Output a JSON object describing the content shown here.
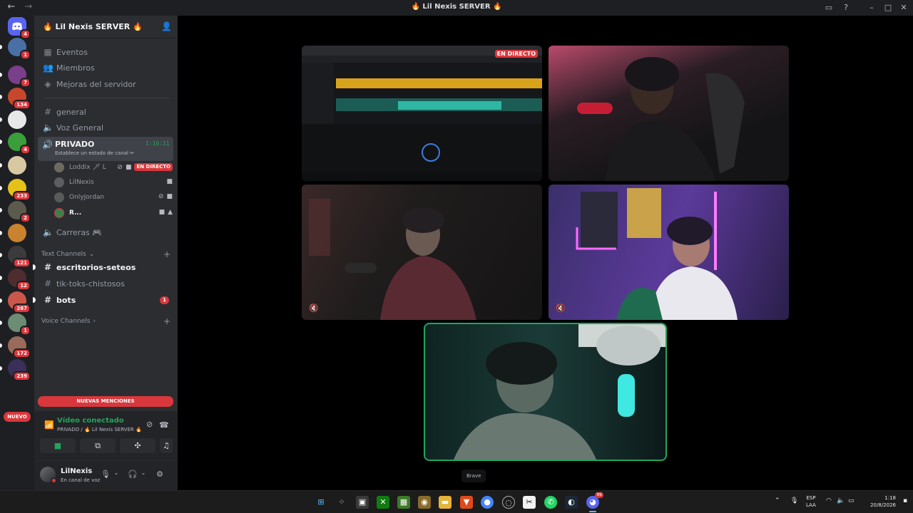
{
  "window": {
    "title": "🔥 Lil Nexis SERVER 🔥",
    "back_glyph": "←",
    "forward_glyph": "→"
  },
  "server_rail": {
    "home_badge": "4",
    "servers": [
      {
        "badge": "1",
        "color": "#4a6fa5"
      },
      {
        "badge": "7",
        "color": "#7a3f8a"
      },
      {
        "badge": "134",
        "color": "#c7462c"
      },
      {
        "badge": "",
        "color": "#e8e8e8"
      },
      {
        "badge": "4",
        "color": "#3a9f3a"
      },
      {
        "badge": "",
        "color": "#d9c9a3"
      },
      {
        "badge": "233",
        "color": "#e5c21a"
      },
      {
        "badge": "2",
        "color": "#5b5a4c"
      },
      {
        "badge": "",
        "color": "#c9822e"
      },
      {
        "badge": "121",
        "color": "#3b3b3b"
      },
      {
        "badge": "12",
        "color": "#4d2d2d"
      },
      {
        "badge": "287",
        "color": "#c9584a"
      },
      {
        "badge": "1",
        "color": "#6c8c74"
      },
      {
        "badge": "172",
        "color": "#9a6b5a"
      },
      {
        "badge": "239",
        "color": "#3a2f58"
      }
    ],
    "new_label": "NUEVO"
  },
  "guild": {
    "name": "🔥 Lil Nexis SERVER 🔥",
    "menu_items": [
      "Eventos",
      "Miembros",
      "Mejoras del servidor"
    ],
    "channels_top": [
      {
        "name": "general",
        "kind": "text"
      },
      {
        "name": "Voz General",
        "kind": "voice"
      }
    ],
    "active_voice": {
      "name": "PRIVADO",
      "timer": "1:16:11",
      "status": "Establece un estado de canal ✏"
    },
    "voice_users": [
      {
        "name": "Loddix 🗡 L",
        "live": "EN DIRECTO",
        "color": "#6e6a5f"
      },
      {
        "name": "LilNexis",
        "live": "",
        "color": "#5c5e63"
      },
      {
        "name": "OnlyJordan",
        "live": "",
        "color": "#5a5a5a"
      },
      {
        "name": "R...",
        "live": "",
        "color": "#3f7d4a"
      }
    ],
    "other_voice": "Carreras 🎮",
    "text_category": "Text Channels",
    "text_channels": [
      {
        "name": "escritorios-seteos",
        "unread": true,
        "mentions": ""
      },
      {
        "name": "tik-toks-chistosos",
        "unread": false,
        "mentions": ""
      },
      {
        "name": "bots",
        "unread": true,
        "mentions": "1"
      }
    ],
    "voice_category": "Voice Channels",
    "new_mentions": "NUEVAS MENCIONES"
  },
  "rtc": {
    "status": "Vídeo conectado",
    "location": "PRIVADO / 🔥 Lil Nexis SERVER 🔥"
  },
  "user_panel": {
    "username": "LilNexis",
    "status": "En canal de voz"
  },
  "stage": {
    "stream_live_label": "EN DIRECTO",
    "tooltip": "Brave"
  },
  "taskbar": {
    "lang_top": "ESP",
    "lang_bottom": "LAA",
    "time": "1:18",
    "date": "20/8/2026",
    "discord_badge": "99"
  }
}
